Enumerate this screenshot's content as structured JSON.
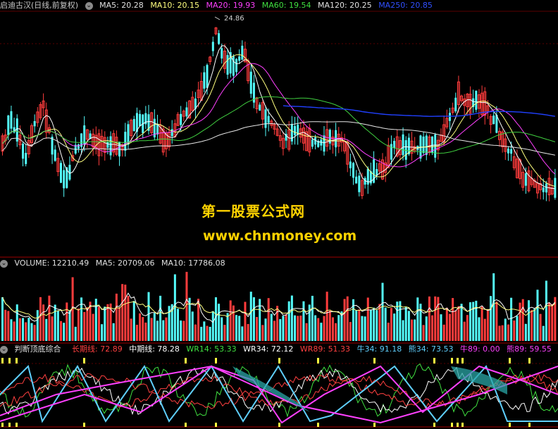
{
  "price_panel": {
    "stock_label": "启迪古汉(日线,前复权)",
    "ma5": "MA5: 20.28",
    "ma10": "MA10: 20.15",
    "ma20": "MA20: 19.93",
    "ma60": "MA60: 19.54",
    "ma120": "MA120: 20.25",
    "ma250": "MA250: 20.85",
    "high_marker": "24.86"
  },
  "volume_panel": {
    "volume": "VOLUME: 12210.49",
    "ma5": "MA5: 20709.06",
    "ma10": "MA10: 17786.08"
  },
  "indicator_panel": {
    "name": "判断顶底综合",
    "long_line": "长期线: 72.89",
    "mid_line": "中期线: 78.28",
    "wr14": "WR14: 53.33",
    "wr34": "WR34: 72.12",
    "wr89": "WR89: 51.33",
    "niu34": "牛34: 91.18",
    "xiong34": "熊34: 73.53",
    "niu89": "牛89: 0.00",
    "xiong89": "熊89: 59.55"
  },
  "watermark": {
    "title": "第一股票公式网",
    "url": "www.chnmoney.com"
  },
  "colors": {
    "up_candle": "#ff3c3c",
    "down_candle": "#54fcfc",
    "ma5": "#ffffff",
    "ma10": "#ffff7f",
    "ma20": "#ff40ff",
    "ma60": "#40d040",
    "ma120": "#e8e8e8",
    "ma250": "#2040ff",
    "watermark": "#ffd300"
  },
  "chart_data": {
    "type": "candlestick",
    "price_high": 24.86,
    "moving_averages": {
      "MA5": 20.28,
      "MA10": 20.15,
      "MA20": 19.93,
      "MA60": 19.54,
      "MA120": 20.25,
      "MA250": 20.85
    },
    "volume": {
      "VOLUME": 12210.49,
      "MA5": 20709.06,
      "MA10": 17786.08
    },
    "indicator": {
      "长期线": 72.89,
      "中期线": 78.28,
      "WR14": 53.33,
      "WR34": 72.12,
      "WR89": 51.33,
      "牛34": 91.18,
      "熊34": 73.53,
      "牛89": 0.0,
      "熊89": 59.55
    }
  }
}
